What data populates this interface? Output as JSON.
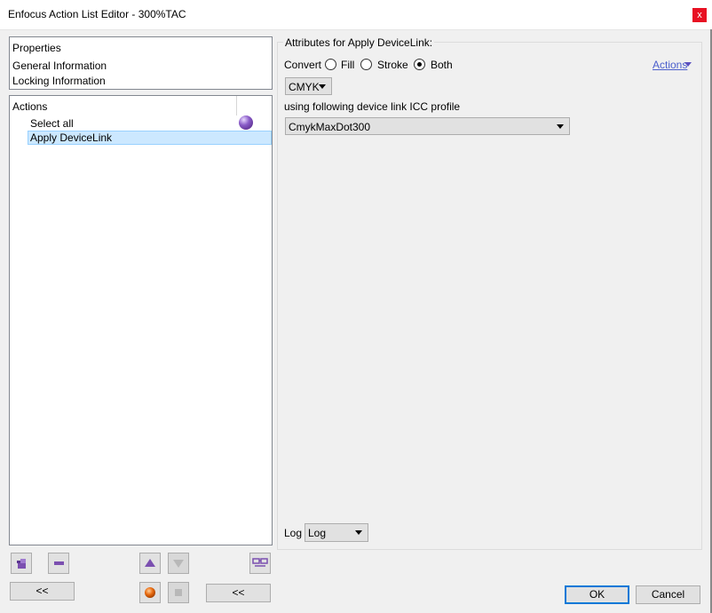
{
  "window": {
    "title": "Enfocus Action List Editor - 300%TAC",
    "close_glyph": "x"
  },
  "properties": {
    "header": "Properties",
    "items": [
      "General Information",
      "Locking Information"
    ]
  },
  "actions_panel": {
    "header": "Actions",
    "items": [
      {
        "label": "Select all"
      },
      {
        "label": "Apply DeviceLink",
        "selected": true
      }
    ]
  },
  "attributes": {
    "legend": "Attributes for Apply DeviceLink:",
    "convert_label": "Convert",
    "options": [
      {
        "label": "Fill",
        "checked": false
      },
      {
        "label": "Stroke",
        "checked": false
      },
      {
        "label": "Both",
        "checked": true
      }
    ],
    "actions_link": "Actions",
    "colorspace": "CMYK",
    "profile_label": "using following device link ICC profile",
    "profile": "CmykMaxDot300",
    "log_label": "Log",
    "log_value": "Log"
  },
  "buttons": {
    "collapse_left": "<<",
    "collapse_right": "<<",
    "ok": "OK",
    "cancel": "Cancel"
  },
  "icons": {
    "add": "add-action-icon",
    "remove": "remove-action-icon",
    "move_up": "move-up-icon",
    "move_down": "move-down-icon",
    "view": "glasses-icon",
    "record": "record-icon",
    "stop": "stop-icon",
    "status": "purple-orb-icon"
  },
  "colors": {
    "accent": "#0078d7",
    "selection": "#cce8ff",
    "link": "#4a5ecc",
    "close": "#e81123",
    "icon_purple": "#7b4fb0",
    "record": "#e86a10"
  }
}
